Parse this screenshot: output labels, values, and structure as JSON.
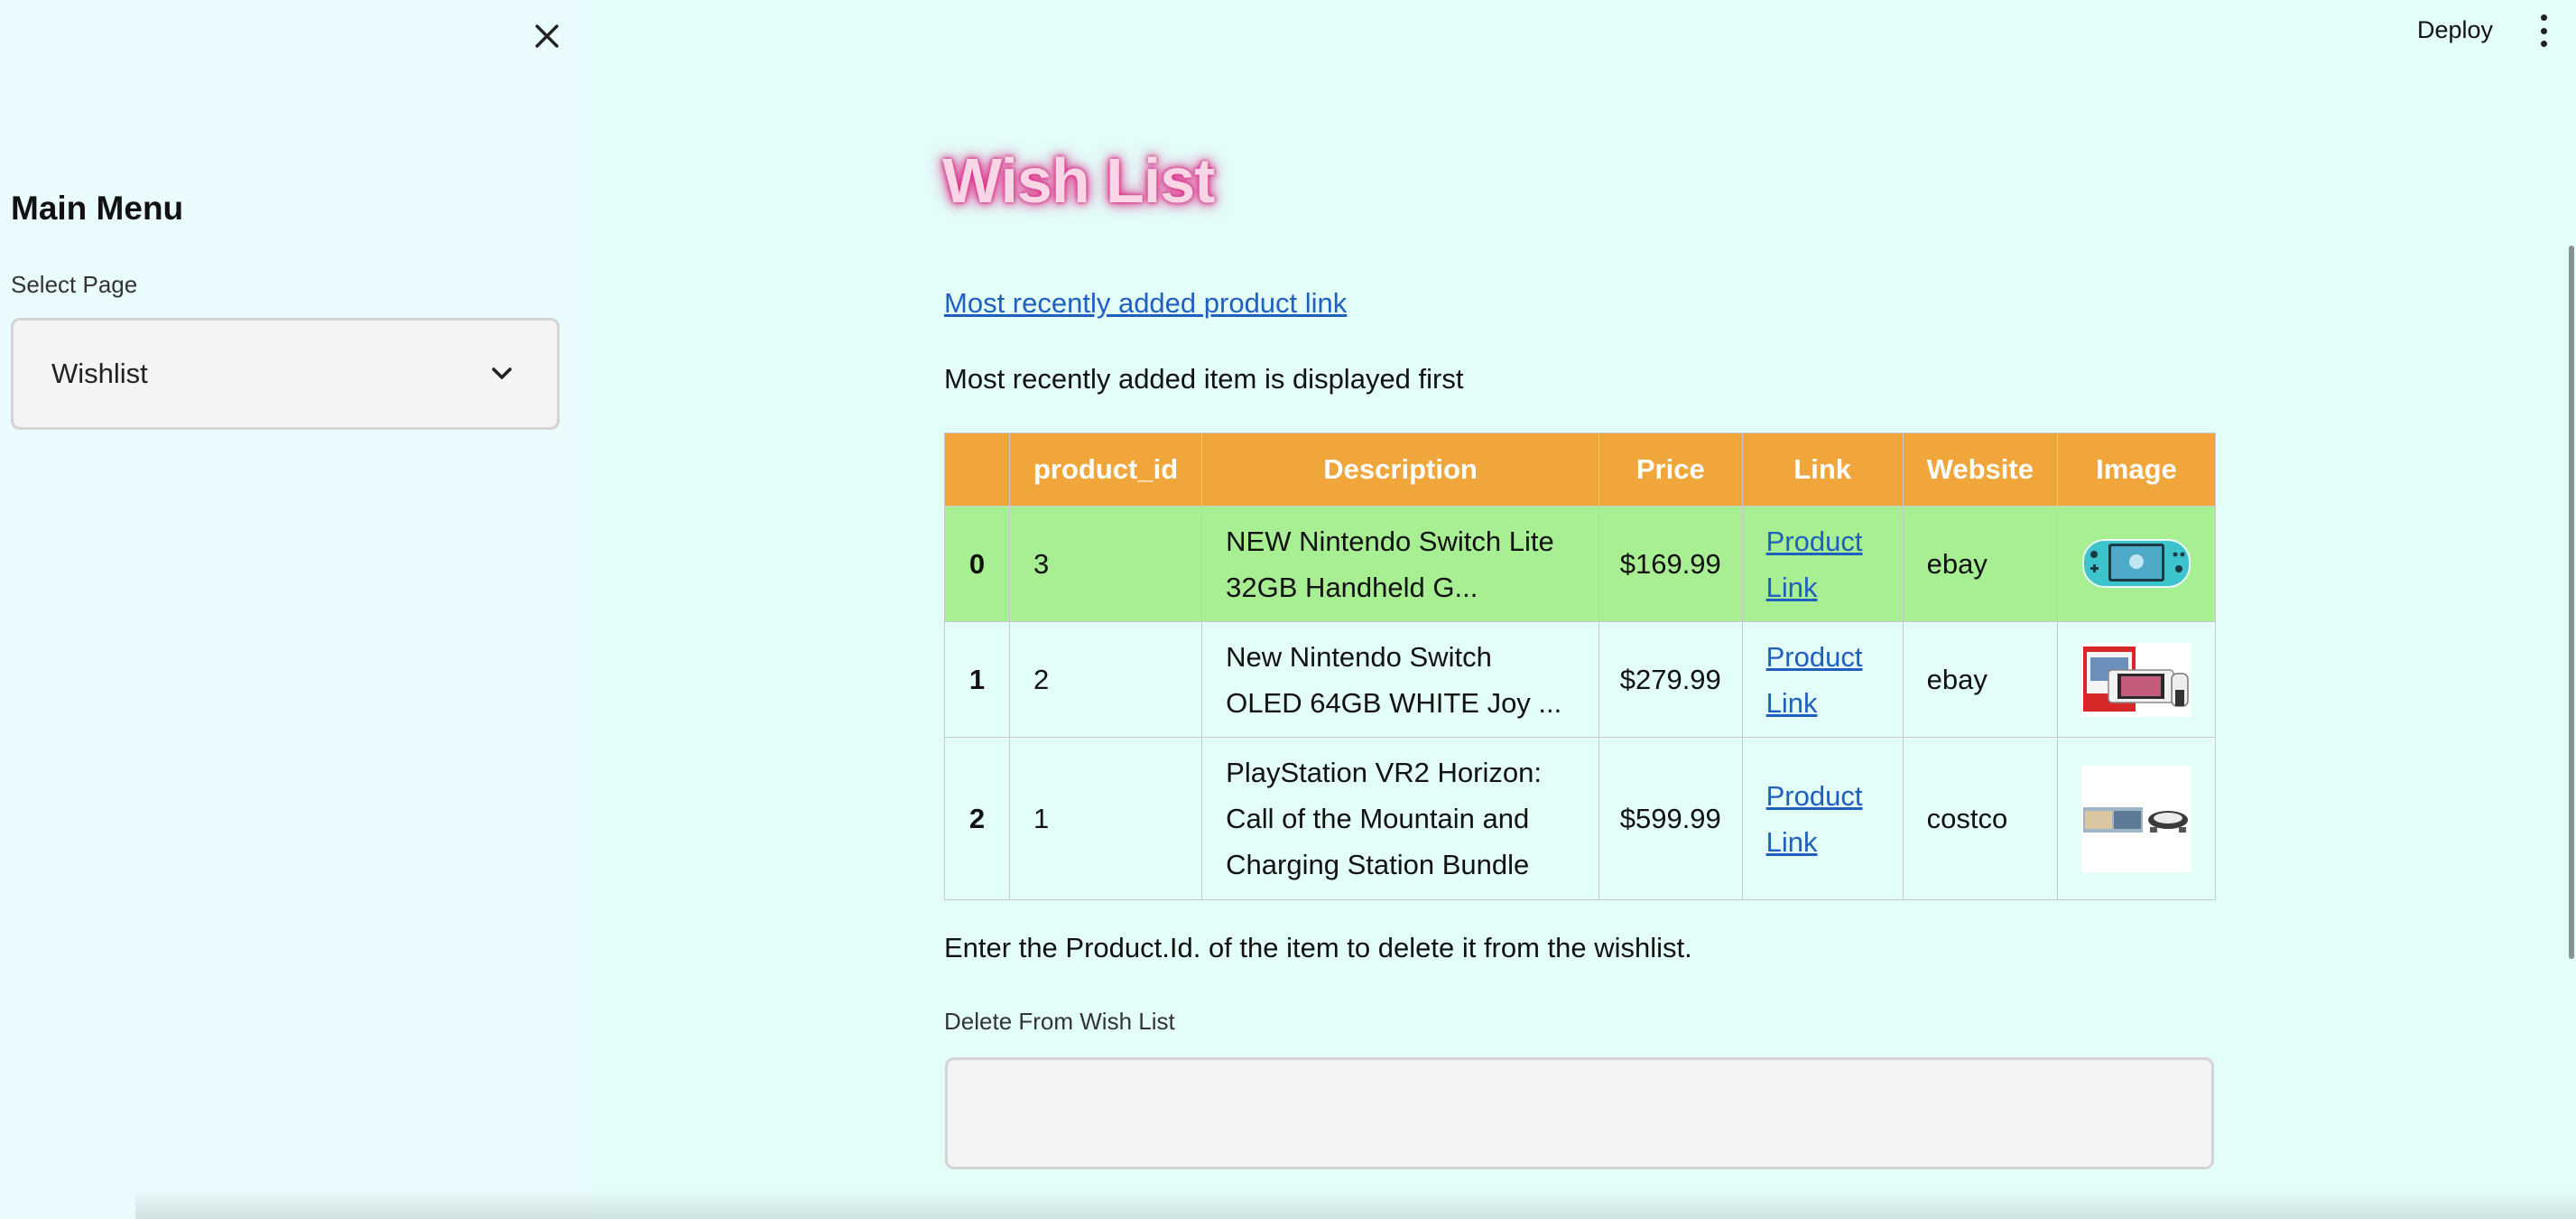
{
  "sidebar": {
    "title": "Main Menu",
    "select_label": "Select Page",
    "select_value": "Wishlist"
  },
  "header": {
    "deploy_label": "Deploy"
  },
  "main": {
    "title": "Wish List",
    "recent_link": "Most recently added product link",
    "order_note": "Most recently added item is displayed first",
    "table": {
      "columns": [
        "",
        "product_id",
        "Description",
        "Price",
        "Link",
        "Website",
        "Image"
      ],
      "rows": [
        {
          "index": "0",
          "product_id": "3",
          "description": "NEW Nintendo Switch Lite 32GB Handheld G...",
          "price": "$169.99",
          "link": "Product Link",
          "website": "ebay",
          "image": "teal Nintendo Switch Lite"
        },
        {
          "index": "1",
          "product_id": "2",
          "description": "New Nintendo Switch OLED 64GB WHITE Joy ...",
          "price": "$279.99",
          "link": "Product Link",
          "website": "ebay",
          "image": "Nintendo Switch OLED box"
        },
        {
          "index": "2",
          "product_id": "1",
          "description": "PlayStation VR2 Horizon: Call of the Mountain and Charging Station Bundle",
          "price": "$599.99",
          "link": "Product Link",
          "website": "costco",
          "image": "PlayStation VR2 bundle"
        }
      ]
    },
    "delete_note": "Enter the Product.Id. of the item to delete it from the wishlist.",
    "delete_label": "Delete From Wish List",
    "delete_value": ""
  },
  "colors": {
    "background": "#e3fdf9",
    "sidebar_background": "#eafbfd",
    "table_header": "#f0a63a",
    "highlight_row": "#a8ee92",
    "link": "#1f5fbf",
    "title_glow": "#e02d8a"
  }
}
